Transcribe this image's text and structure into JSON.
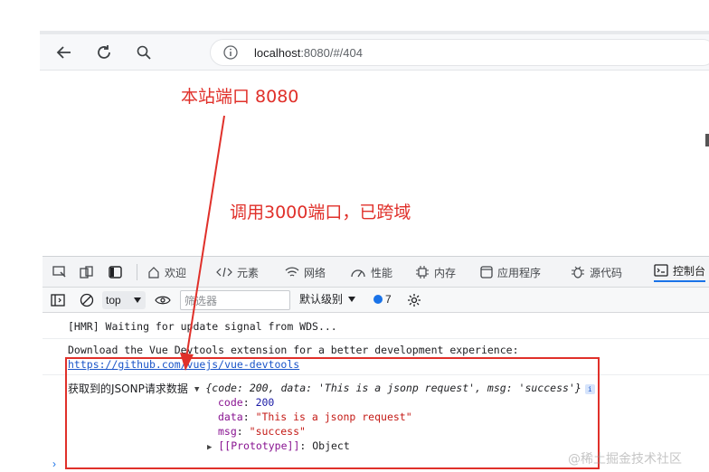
{
  "browser": {
    "url_host": "localhost",
    "url_path": ":8080/#/404"
  },
  "annotations": {
    "site_port": "本站端口 8080",
    "cross_origin": "调用3000端口，已跨域"
  },
  "devtools": {
    "tabs": [
      {
        "label": "欢迎",
        "icon": "home-icon"
      },
      {
        "label": "元素",
        "icon": "code-icon"
      },
      {
        "label": "网络",
        "icon": "wifi-icon"
      },
      {
        "label": "性能",
        "icon": "gauge-icon"
      },
      {
        "label": "内存",
        "icon": "chip-icon"
      },
      {
        "label": "应用程序",
        "icon": "app-icon"
      },
      {
        "label": "源代码",
        "icon": "bug-icon"
      },
      {
        "label": "控制台",
        "icon": "console-icon"
      }
    ],
    "toolbar": {
      "context": "top",
      "filter_placeholder": "筛选器",
      "levels": "默认级别",
      "message_count": "7"
    }
  },
  "console": {
    "hmr": "[HMR] Waiting for update signal from WDS...",
    "vue_msg": "Download the Vue Devtools extension for a better development experience:",
    "vue_link": "https://github.com/vuejs/vue-devtools",
    "jsonp_label": "获取到的JSONP请求数据",
    "summary": "{code: 200, data: 'This is a jsonp request', msg: 'success'}",
    "code_key": "code",
    "code_val": "200",
    "data_key": "data",
    "data_val": "\"This is a jsonp request\"",
    "msg_key": "msg",
    "msg_val": "\"success\"",
    "proto_key": "[[Prototype]]",
    "proto_val": "Object"
  },
  "watermark": "@稀土掘金技术社区",
  "colors": {
    "annotation_red": "#e0302a",
    "accent_blue": "#1a73e8"
  }
}
